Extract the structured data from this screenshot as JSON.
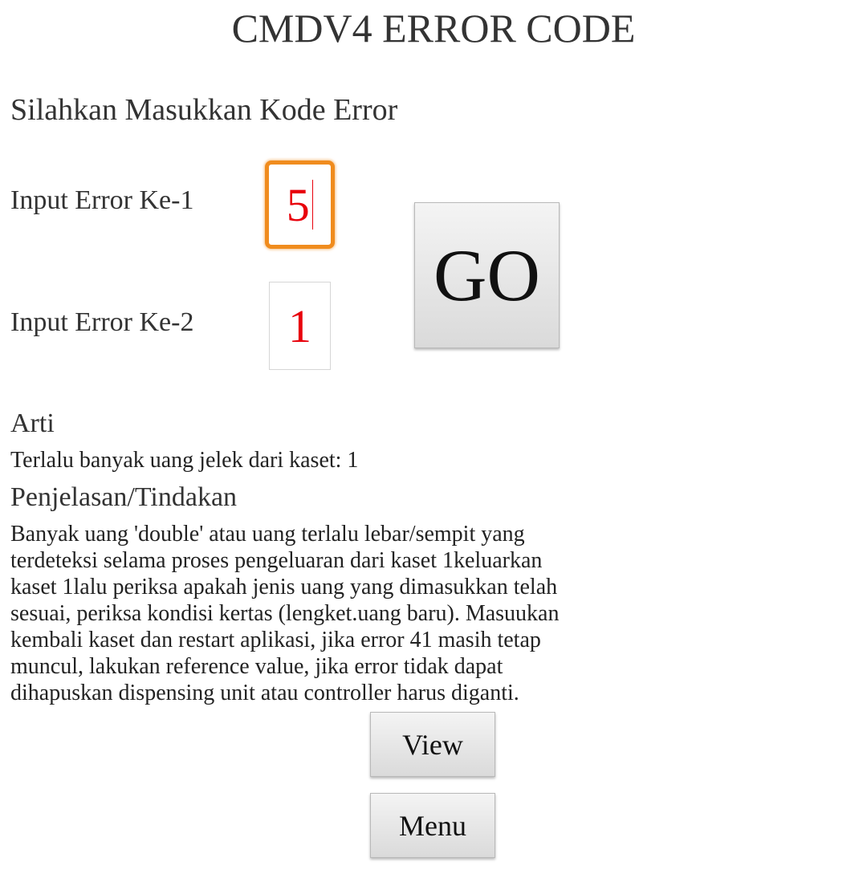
{
  "header": {
    "title": "CMDV4 ERROR CODE"
  },
  "form": {
    "subtitle": "Silahkan Masukkan Kode Error",
    "input1_label": "Input Error Ke-1",
    "input1_value": "5",
    "input2_label": "Input Error Ke-2",
    "input2_value": "1",
    "go_label": "GO"
  },
  "result": {
    "meaning_heading": "Arti",
    "meaning_text": "Terlalu banyak uang jelek dari kaset: 1",
    "explain_heading": "Penjelasan/Tindakan",
    "explain_lines": [
      "Banyak uang 'double' atau uang terlalu lebar/sempit yang",
      "terdeteksi selama proses pengeluaran dari kaset 1keluarkan",
      "kaset 1lalu periksa apakah jenis uang yang dimasukkan telah",
      "sesuai, periksa kondisi kertas (lengket.uang baru). Masuukan",
      "kembali kaset dan restart aplikasi, jika error 41 masih tetap",
      "muncul, lakukan reference value, jika error tidak dapat",
      "dihapuskan dispensing unit atau controller harus diganti."
    ]
  },
  "actions": {
    "view_label": "View",
    "menu_label": "Menu"
  },
  "colors": {
    "input_text": "#e8000b",
    "focus_border": "#f08c1e",
    "background": "#ffffff"
  }
}
